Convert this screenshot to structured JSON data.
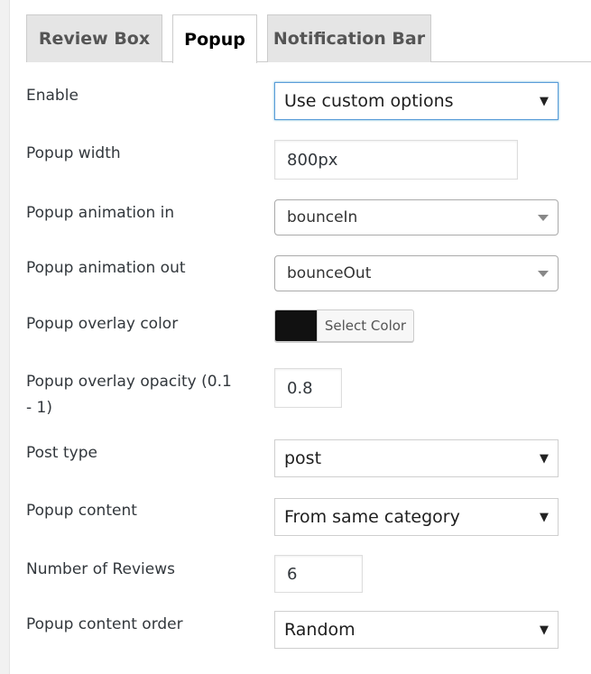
{
  "tabs": [
    {
      "label": "Review Box",
      "active": false
    },
    {
      "label": "Popup",
      "active": true
    },
    {
      "label": "Notification Bar",
      "active": false
    }
  ],
  "fields": {
    "enable": {
      "label": "Enable",
      "value": "Use custom options"
    },
    "popup_width": {
      "label": "Popup width",
      "value": "800px"
    },
    "animation_in": {
      "label": "Popup animation in",
      "value": "bounceIn"
    },
    "animation_out": {
      "label": "Popup animation out",
      "value": "bounceOut"
    },
    "overlay_color": {
      "label": "Popup overlay color",
      "button_label": "Select Color",
      "color": "#111111"
    },
    "overlay_opacity": {
      "label": "Popup overlay opacity (0.1 - 1)",
      "value": "0.8"
    },
    "post_type": {
      "label": "Post type",
      "value": "post"
    },
    "popup_content": {
      "label": "Popup content",
      "value": "From same category"
    },
    "number_of_reviews": {
      "label": "Number of Reviews",
      "value": "6"
    },
    "content_order": {
      "label": "Popup content order",
      "value": "Random"
    }
  },
  "icons": {
    "native_select_arrow": "▼",
    "styled_select_arrow": "triangle-down"
  },
  "colors": {
    "focus_border": "#5b9dd9",
    "tab_inactive_bg": "#e5e5e5",
    "page_bg": "#f1f1f1"
  }
}
